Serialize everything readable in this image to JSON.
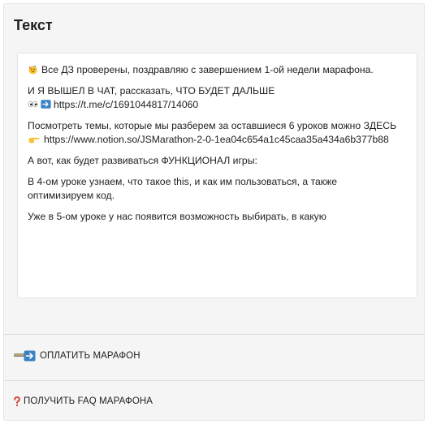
{
  "panel": {
    "title": "Текст"
  },
  "message": {
    "line1": "Все ДЗ проверены, поздравляю с завершением 1-ой недели марафона.",
    "line2_text": "И Я ВЫШЕЛ В ЧАТ, рассказать, ЧТО БУДЕТ ДАЛЬШЕ",
    "line2_link": "https://t.me/c/1691044817/14060",
    "line3_text": "Посмотреть темы, которые мы разберем за оставшиеся  6 уроков можно ЗДЕСЬ",
    "line3_link": "https://www.notion.so/JSMarathon-2-0-1ea04c654a1c45caa35a434a6b377b88",
    "line4": "А вот, как будет развиваться ФУНКЦИОНАЛ игры:",
    "line5": "В 4-ом уроке узнаем, что такое this, и как им пользоваться, а также оптимизируем код.",
    "line6": "Уже в 5-ом уроке у нас появится возможность выбирать, в какую"
  },
  "actions": {
    "pay_label": "ОПЛАТИТЬ МАРАФОН",
    "faq_label": "ПОЛУЧИТЬ FAQ МАРАФОНА"
  },
  "icons": {
    "party": "party-face-icon",
    "eyes": "eyes-icon",
    "arrow_right_box": "right-arrow-box-icon",
    "pointing_hand": "pointing-hand-icon",
    "card_arrow": "card-arrow-icon",
    "question": "question-mark-icon"
  },
  "colors": {
    "panel_bg": "#f5f5f5",
    "card_bg": "#ffffff",
    "accent_blue": "#3b82c4",
    "question_red": "#d9302b"
  }
}
